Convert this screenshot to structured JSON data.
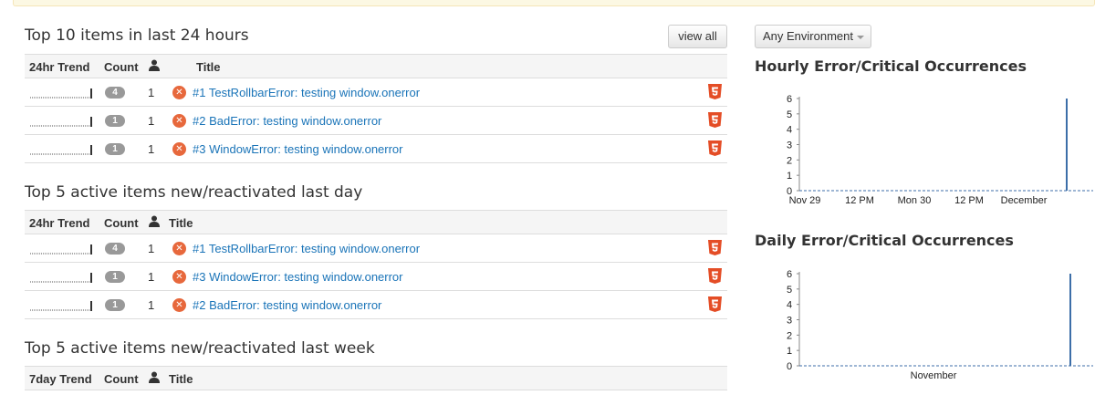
{
  "top10": {
    "title": "Top 10 items in last 24 hours",
    "view_all_label": "view all",
    "columns": {
      "trend": "24hr Trend",
      "count": "Count",
      "user_icon": "user-icon",
      "title": "Title"
    },
    "rows": [
      {
        "badge": "4",
        "count": "1",
        "title": "#1 TestRollbarError: testing window.onerror"
      },
      {
        "badge": "1",
        "count": "1",
        "title": "#2 BadError: testing window.onerror"
      },
      {
        "badge": "1",
        "count": "1",
        "title": "#3 WindowError: testing window.onerror"
      }
    ]
  },
  "top5day": {
    "title": "Top 5 active items new/reactivated last day",
    "columns": {
      "trend": "24hr Trend",
      "count": "Count",
      "user_icon": "user-icon",
      "title": "Title"
    },
    "rows": [
      {
        "badge": "4",
        "count": "1",
        "title": "#1 TestRollbarError: testing window.onerror"
      },
      {
        "badge": "1",
        "count": "1",
        "title": "#3 WindowError: testing window.onerror"
      },
      {
        "badge": "1",
        "count": "1",
        "title": "#2 BadError: testing window.onerror"
      }
    ]
  },
  "top5week": {
    "title": "Top 5 active items new/reactivated last week",
    "columns": {
      "trend": "7day Trend",
      "count": "Count",
      "user_icon": "user-icon",
      "title": "Title"
    }
  },
  "environment": {
    "label": "Any Environment",
    "icon": "caret-down-icon"
  },
  "icons": {
    "error": "error-x-icon",
    "platform": "html5-icon"
  },
  "colors": {
    "link": "#1a74b8",
    "error": "#e7683c",
    "html5": "#e44d26",
    "bar": "#3c6ea8",
    "badge": "#999999"
  },
  "chart_data": [
    {
      "type": "bar",
      "title": "Hourly Error/Critical Occurrences",
      "x_tick_labels": [
        "Nov 29",
        "12 PM",
        "Mon 30",
        "12 PM",
        "December"
      ],
      "y_ticks": [
        0,
        1,
        2,
        3,
        4,
        5,
        6
      ],
      "ylim": [
        0,
        6
      ],
      "bars": [
        {
          "x": "December (latest hour)",
          "value": 6
        }
      ]
    },
    {
      "type": "bar",
      "title": "Daily Error/Critical Occurrences",
      "x_tick_labels": [
        "November"
      ],
      "y_ticks": [
        0,
        1,
        2,
        3,
        4,
        5,
        6
      ],
      "ylim": [
        0,
        6
      ],
      "bars": [
        {
          "x": "latest day",
          "value": 6
        }
      ]
    }
  ]
}
